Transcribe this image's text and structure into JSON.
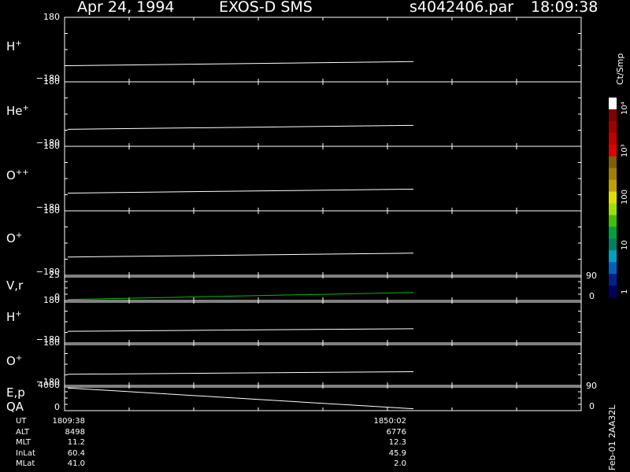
{
  "header": {
    "date": "Apr 24, 1994",
    "mission": "EXOS-D SMS",
    "file": "s4042406.par",
    "time": "18:09:38"
  },
  "colorbar": {
    "title": "Ct/Smp",
    "labels": [
      "1",
      "10",
      "100",
      "10³",
      "10⁴"
    ],
    "colors": [
      "#000060",
      "#00208c",
      "#0060c0",
      "#00a0c0",
      "#008060",
      "#00a040",
      "#40c000",
      "#a0e000",
      "#e0e000",
      "#c0a000",
      "#a08000",
      "#806000",
      "#e00000",
      "#c00000",
      "#a00000",
      "#800000",
      "#ffffff"
    ]
  },
  "panels": [
    {
      "id": "h-plus",
      "label": "H",
      "sup": "+",
      "ymax": "180",
      "ymin": "−180"
    },
    {
      "id": "he-plus",
      "label": "He",
      "sup": "+",
      "ymax": "180",
      "ymin": "−180"
    },
    {
      "id": "o-plus-plus",
      "label": "O",
      "sup": "++",
      "ymax": "180",
      "ymin": "−180"
    },
    {
      "id": "o-plus",
      "label": "O",
      "sup": "+",
      "ymax": "180",
      "ymin": "−180"
    },
    {
      "id": "vr",
      "label": "V,r",
      "sup": "",
      "ymax": "25",
      "ymin": "0",
      "right_max": "90",
      "right_min": "0"
    },
    {
      "id": "h-plus-2",
      "label": "H",
      "sup": "+",
      "ymax": "180",
      "ymin": "−180"
    },
    {
      "id": "o-plus-2",
      "label": "O",
      "sup": "+",
      "ymax": "180",
      "ymin": "−180"
    },
    {
      "id": "ep",
      "label": "E,p",
      "sup": "",
      "label2": "QA",
      "ymax": "4000",
      "ymin": "0",
      "right_max": "90",
      "right_min": "0"
    }
  ],
  "footer": {
    "rows": [
      {
        "name": "UT",
        "start": "1809:38",
        "end": "1850:02"
      },
      {
        "name": "ALT",
        "start": "8498",
        "end": "6776"
      },
      {
        "name": "MLT",
        "start": "11.2",
        "end": "12.3"
      },
      {
        "name": "InLat",
        "start": "60.4",
        "end": "45.9"
      },
      {
        "name": "MLat",
        "start": "41.0",
        "end": "2.0"
      }
    ],
    "stamp": "Feb-01 2AA32L"
  },
  "chart_data": {
    "type": "line",
    "x": [
      "1809:38",
      "1850:02"
    ],
    "series": [
      {
        "name": "H+",
        "values": [
          -90,
          -67
        ],
        "ylim": [
          -180,
          180
        ]
      },
      {
        "name": "He+",
        "values": [
          -85,
          -63
        ],
        "ylim": [
          -180,
          180
        ]
      },
      {
        "name": "O++",
        "values": [
          -81,
          -59
        ],
        "ylim": [
          -180,
          180
        ]
      },
      {
        "name": "O+",
        "values": [
          -78,
          -56
        ],
        "ylim": [
          -180,
          180
        ]
      },
      {
        "name": "V,r",
        "values": [
          1,
          8
        ],
        "ylim": [
          0,
          25
        ],
        "color": "#00c000"
      },
      {
        "name": "H+",
        "values": [
          -81,
          -59
        ],
        "ylim": [
          -180,
          180
        ]
      },
      {
        "name": "O+",
        "values": [
          -85,
          -63
        ],
        "ylim": [
          -180,
          180
        ]
      },
      {
        "name": "E,p",
        "values": [
          3600,
          300
        ],
        "ylim": [
          0,
          4000
        ]
      }
    ]
  }
}
